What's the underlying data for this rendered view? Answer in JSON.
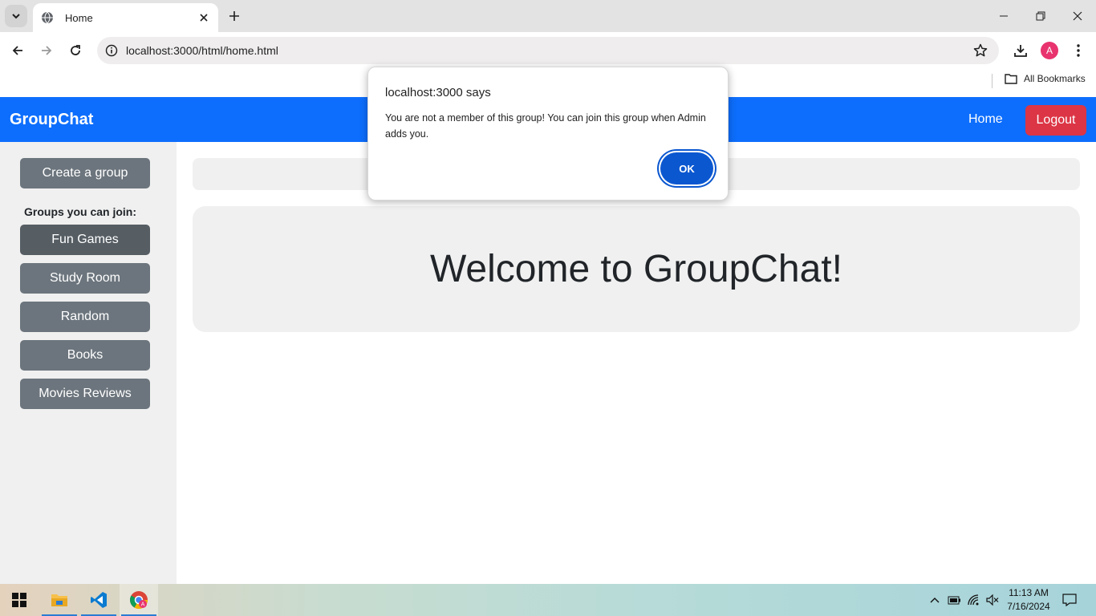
{
  "browser": {
    "tab_title": "Home",
    "url": "localhost:3000/html/home.html",
    "avatar_letter": "A",
    "bookmarks_label": "All Bookmarks"
  },
  "app": {
    "brand": "GroupChat",
    "nav_home": "Home",
    "logout": "Logout",
    "create_group": "Create a group",
    "groups_label": "Groups you can join:",
    "groups": [
      "Fun Games",
      "Study Room",
      "Random",
      "Books",
      "Movies Reviews"
    ],
    "welcome": "Welcome to GroupChat!"
  },
  "dialog": {
    "title": "localhost:3000 says",
    "message": "You are not a member of this group! You can join this group when Admin adds you.",
    "ok": "OK"
  },
  "taskbar": {
    "time": "11:13 AM",
    "date": "7/16/2024"
  },
  "colors": {
    "navbar": "#0d6efd",
    "logout": "#dc3545",
    "group_button": "#6c757d",
    "dialog_ok": "#0b57d0"
  }
}
